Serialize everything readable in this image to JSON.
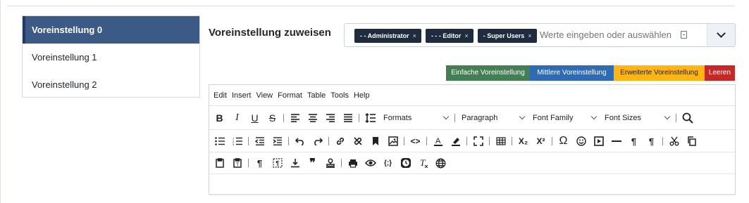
{
  "presets": {
    "items": [
      {
        "label": "Voreinstellung 0",
        "active": true
      },
      {
        "label": "Voreinstellung 1",
        "active": false
      },
      {
        "label": "Voreinstellung 2",
        "active": false
      }
    ]
  },
  "assign": {
    "title": "Voreinstellung zuweisen",
    "tags": [
      {
        "label": "- - Administrator",
        "remove": "×"
      },
      {
        "label": "- - - Editor",
        "remove": "×"
      },
      {
        "label": "- Super Users",
        "remove": "×"
      }
    ],
    "placeholder": "Werte eingeben oder auswählen"
  },
  "preset_buttons": {
    "simple": "Einfache Voreinstellung",
    "medium": "Mittlere Voreinstellung",
    "extended": "Erweiterte Voreinstellung",
    "clear": "Leeren",
    "colors": {
      "simple": "#457d54",
      "medium": "#2f6ab3",
      "extended": "#ffb514",
      "clear": "#c52827"
    }
  },
  "editor": {
    "menu": [
      "Edit",
      "Insert",
      "View",
      "Format",
      "Table",
      "Tools",
      "Help"
    ],
    "dropdowns": {
      "formats": "Formats",
      "paragraph": "Paragraph",
      "font_family": "Font Family",
      "font_sizes": "Font Sizes"
    },
    "toolbar_icons": {
      "bold": "B",
      "italic": "I",
      "underline": "U",
      "strike": "S",
      "subscript": "X₂",
      "superscript": "X²",
      "omega": "Ω",
      "code": "<>",
      "pilcrow": "¶",
      "quote": "❞",
      "code_sample": "{;}",
      "clear_format": "T"
    }
  }
}
